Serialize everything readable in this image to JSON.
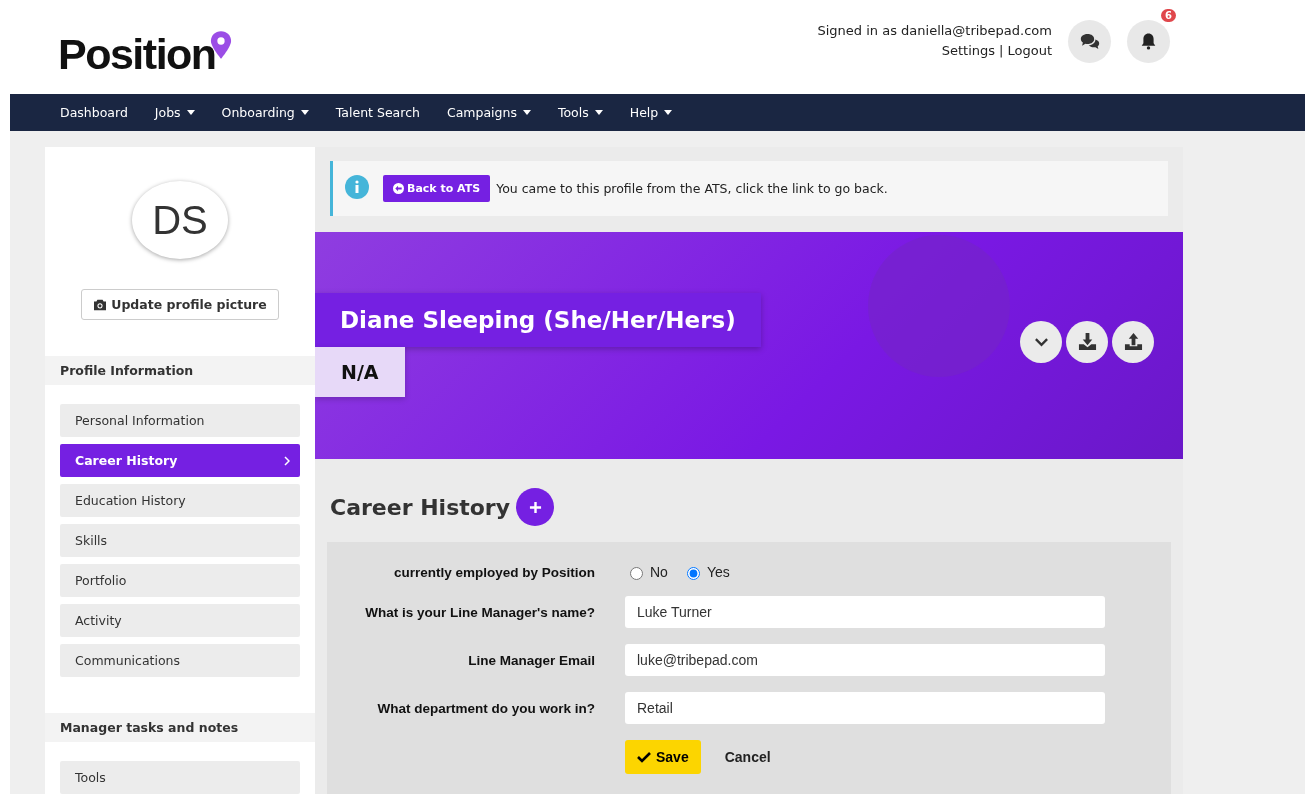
{
  "header": {
    "logo": "Position",
    "signed_in": "Signed in as daniella@tribepad.com",
    "settings": "Settings",
    "separator": "|",
    "logout": "Logout",
    "notifications": "6"
  },
  "nav": [
    {
      "label": "Dashboard",
      "dropdown": false
    },
    {
      "label": "Jobs",
      "dropdown": true
    },
    {
      "label": "Onboarding",
      "dropdown": true
    },
    {
      "label": "Talent Search",
      "dropdown": false
    },
    {
      "label": "Campaigns",
      "dropdown": true
    },
    {
      "label": "Tools",
      "dropdown": true
    },
    {
      "label": "Help",
      "dropdown": true
    }
  ],
  "sidebar": {
    "initials": "DS",
    "update_picture": "Update profile picture",
    "sections": [
      {
        "title": "Profile Information",
        "items": [
          {
            "label": "Personal Information",
            "selected": false
          },
          {
            "label": "Career History",
            "selected": true
          },
          {
            "label": "Education History",
            "selected": false
          },
          {
            "label": "Skills",
            "selected": false
          },
          {
            "label": "Portfolio",
            "selected": false
          },
          {
            "label": "Activity",
            "selected": false
          },
          {
            "label": "Communications",
            "selected": false
          }
        ]
      },
      {
        "title": "Manager tasks and notes",
        "items": [
          {
            "label": "Tools",
            "selected": false
          }
        ]
      }
    ]
  },
  "notice": {
    "button": "Back to ATS",
    "text": "You came to this profile from the ATS, click the link to go back."
  },
  "profile": {
    "name": "Diane Sleeping (She/Her/Hers)",
    "subtitle": "N/A"
  },
  "section_title": "Career History",
  "form": {
    "employed": {
      "label": "currently employed by **Position**",
      "options": [
        {
          "label": "No",
          "selected": false
        },
        {
          "label": "Yes",
          "selected": true
        }
      ]
    },
    "fields": [
      {
        "label": "What is your Line Manager's name?",
        "value": "Luke Turner"
      },
      {
        "label": "Line Manager Email",
        "value": "luke@tribepad.com"
      },
      {
        "label": "What department do you work in?",
        "value": "Retail"
      }
    ],
    "save": "Save",
    "cancel": "Cancel"
  }
}
